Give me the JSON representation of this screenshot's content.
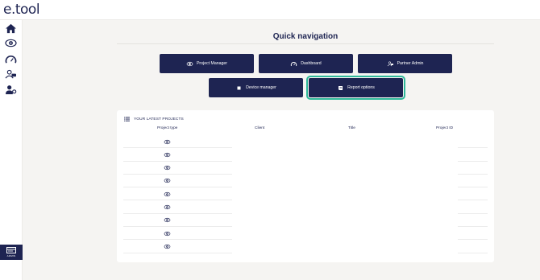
{
  "app": {
    "logo": "e.tool"
  },
  "sidebar": {
    "items": [
      {
        "icon": "home-icon"
      },
      {
        "icon": "eye-gear-icon"
      },
      {
        "icon": "gauge-icon"
      },
      {
        "icon": "partner-handshake-icon"
      },
      {
        "icon": "user-cog-icon"
      }
    ],
    "admin": {
      "icon": "admin-panel-icon",
      "label": "ADMIN"
    }
  },
  "page": {
    "title": "Quick navigation"
  },
  "quick_nav": [
    {
      "label": "Project Manager",
      "icon": "eye-gear-icon"
    },
    {
      "label": "Dashboard",
      "icon": "gauge-icon"
    },
    {
      "label": "Partner Admin",
      "icon": "partner-handshake-icon"
    },
    {
      "label": "Device manager",
      "icon": "device-square-icon"
    },
    {
      "label": "Report options",
      "icon": "report-scroll-icon"
    }
  ],
  "latest_projects": {
    "heading": "YOUR LATEST PROJECTS",
    "heading_icon": "list-icon",
    "columns": [
      "Project type",
      "Client",
      "Title",
      "Project ID"
    ],
    "rows": [
      {
        "type_icon": "eye-gear-icon",
        "client": "",
        "title": "",
        "project_id": ""
      },
      {
        "type_icon": "eye-gear-icon",
        "client": "",
        "title": "",
        "project_id": ""
      },
      {
        "type_icon": "eye-gear-icon",
        "client": "",
        "title": "",
        "project_id": ""
      },
      {
        "type_icon": "eye-gear-icon",
        "client": "",
        "title": "",
        "project_id": ""
      },
      {
        "type_icon": "eye-gear-icon",
        "client": "",
        "title": "",
        "project_id": ""
      },
      {
        "type_icon": "eye-gear-icon",
        "client": "",
        "title": "",
        "project_id": ""
      },
      {
        "type_icon": "eye-gear-icon",
        "client": "",
        "title": "",
        "project_id": ""
      },
      {
        "type_icon": "eye-gear-icon",
        "client": "",
        "title": "",
        "project_id": ""
      },
      {
        "type_icon": "eye-gear-icon",
        "client": "",
        "title": "",
        "project_id": ""
      }
    ]
  },
  "colors": {
    "navy": "#1e2452",
    "focus": "#2fb89a",
    "background": "#f5f4f2"
  }
}
